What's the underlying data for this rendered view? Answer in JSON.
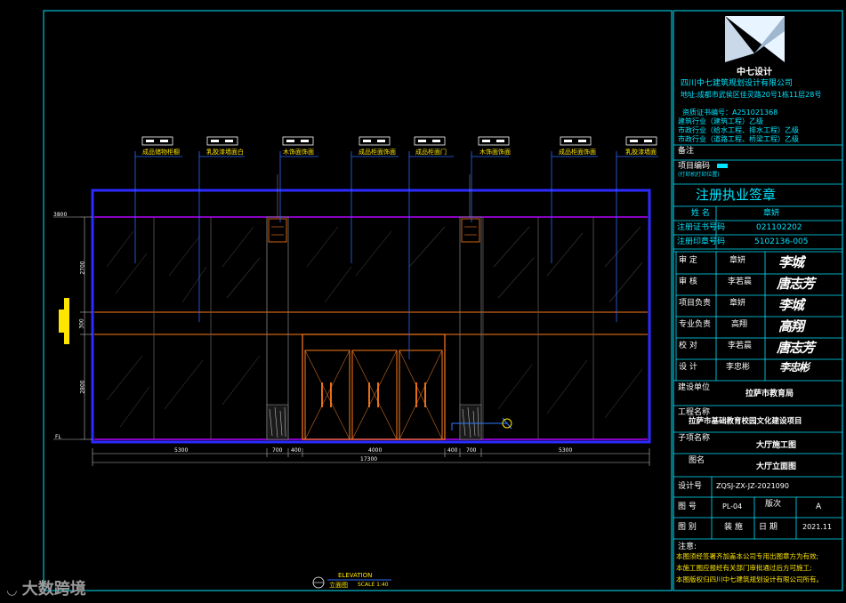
{
  "drawing": {
    "callouts": [
      "成品储物柜橱",
      "乳胶漆墙面白",
      "木饰面饰面",
      "成品柜面饰面",
      "成品柜面门",
      "木饰面饰面",
      "成品柜面饰面",
      "乳胶漆墙面"
    ],
    "level_top": "3800",
    "level_bottom": "FL",
    "vertical_dims": [
      "2700",
      "300",
      "2800"
    ],
    "horizontal_dims": [
      "5300",
      "700",
      "400",
      "4000",
      "400",
      "700",
      "5300"
    ],
    "overall_dim": "17300",
    "title_en": "ELEVATION",
    "title_cn": "立面图",
    "title_scale": "SCALE 1:40"
  },
  "titleblock": {
    "firm_logo_text": "中七设计",
    "firm_name": "四川中七建筑规划设计有限公司",
    "firm_address": "地址:成都市武侯区佳灵路20号1栋11层28号",
    "cert_line1": "资质证书编号：A251021368",
    "cert_line2": "建筑行业（建筑工程）乙级",
    "cert_line3": "市政行业（给水工程、排水工程）乙级",
    "cert_line4": "市政行业（道路工程、桥梁工程）乙级",
    "remarks_label": "备注",
    "project_code_label": "项目编码",
    "project_code_sub": "(打印机打印位置)",
    "reg_stamp_title": "注册执业签章",
    "reg_name_label": "姓  名",
    "reg_name_value": "章妍",
    "reg_cert_label": "注册证书号码",
    "reg_cert_value": "021102202",
    "reg_seal_label": "注册印章号码",
    "reg_seal_value": "5102136-005",
    "roles": [
      {
        "label": "审    定",
        "name": "章妍",
        "sig": "李城"
      },
      {
        "label": "审    核",
        "name": "李若晨",
        "sig": "唐志芳"
      },
      {
        "label": "项目负责",
        "name": "章妍",
        "sig": "李城"
      },
      {
        "label": "专业负责",
        "name": "高翔",
        "sig": "高翔"
      },
      {
        "label": "校    对",
        "name": "李若晨",
        "sig": "唐志芳"
      },
      {
        "label": "设    计",
        "name": "李忠彬",
        "sig": "李忠彬"
      }
    ],
    "client_label": "建设单位",
    "client_value": "拉萨市教育局",
    "project_label": "工程名称",
    "project_value": "拉萨市基础教育校园文化建设项目",
    "subproject_label": "子项名称",
    "subproject_value": "大厅施工图",
    "drawing_name_label": "图名",
    "drawing_name_value": "大厅立面图",
    "design_no_label": "设计号",
    "design_no_value": "ZQSJ-ZX-JZ-2021090",
    "sheet_no_label": "图    号",
    "sheet_no_value": "PL-04",
    "revision_label": "版次",
    "revision_value": "A",
    "category_label": "图    别",
    "category_value": "装 施",
    "date_label": "日    期",
    "date_value": "2021.11",
    "notes_label": "注意:",
    "notes": [
      "本图须经签署齐加盖本公司专用出图章方为有效;",
      "本施工图应报经有关部门审批通过后方可施工;",
      "本图版权归四川中七建筑规划设计有限公司所有。"
    ]
  },
  "watermark": "大数跨境"
}
